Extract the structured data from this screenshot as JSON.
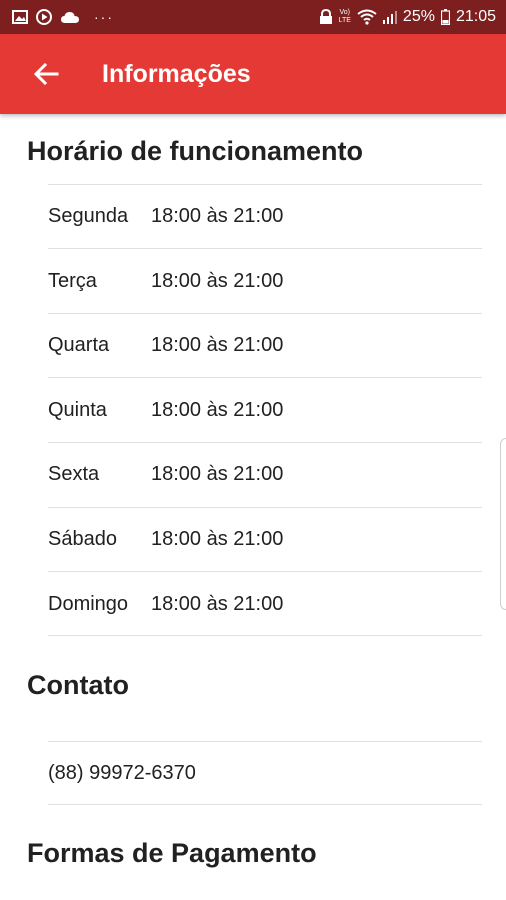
{
  "status_bar": {
    "notification_icons": [
      "image-icon",
      "play-icon",
      "cloud-icon"
    ],
    "more_dots": "···",
    "network_label_top": "Vo)",
    "network_label_bottom": "LTE",
    "battery_percent": "25%",
    "time": "21:05"
  },
  "app_bar": {
    "title": "Informações",
    "background_color": "#e53935",
    "status_color": "#7d1f1f"
  },
  "hours_section": {
    "title": "Horário de funcionamento",
    "rows": [
      {
        "day": "Segunda",
        "hours": "18:00 às 21:00"
      },
      {
        "day": "Terça",
        "hours": "18:00 às 21:00"
      },
      {
        "day": "Quarta",
        "hours": "18:00 às 21:00"
      },
      {
        "day": "Quinta",
        "hours": "18:00 às 21:00"
      },
      {
        "day": "Sexta",
        "hours": "18:00 às 21:00"
      },
      {
        "day": "Sábado",
        "hours": "18:00 às 21:00"
      },
      {
        "day": "Domingo",
        "hours": "18:00 às 21:00"
      }
    ]
  },
  "contact_section": {
    "title": "Contato",
    "phone": "(88) 99972-6370"
  },
  "payment_section": {
    "title": "Formas de Pagamento"
  }
}
